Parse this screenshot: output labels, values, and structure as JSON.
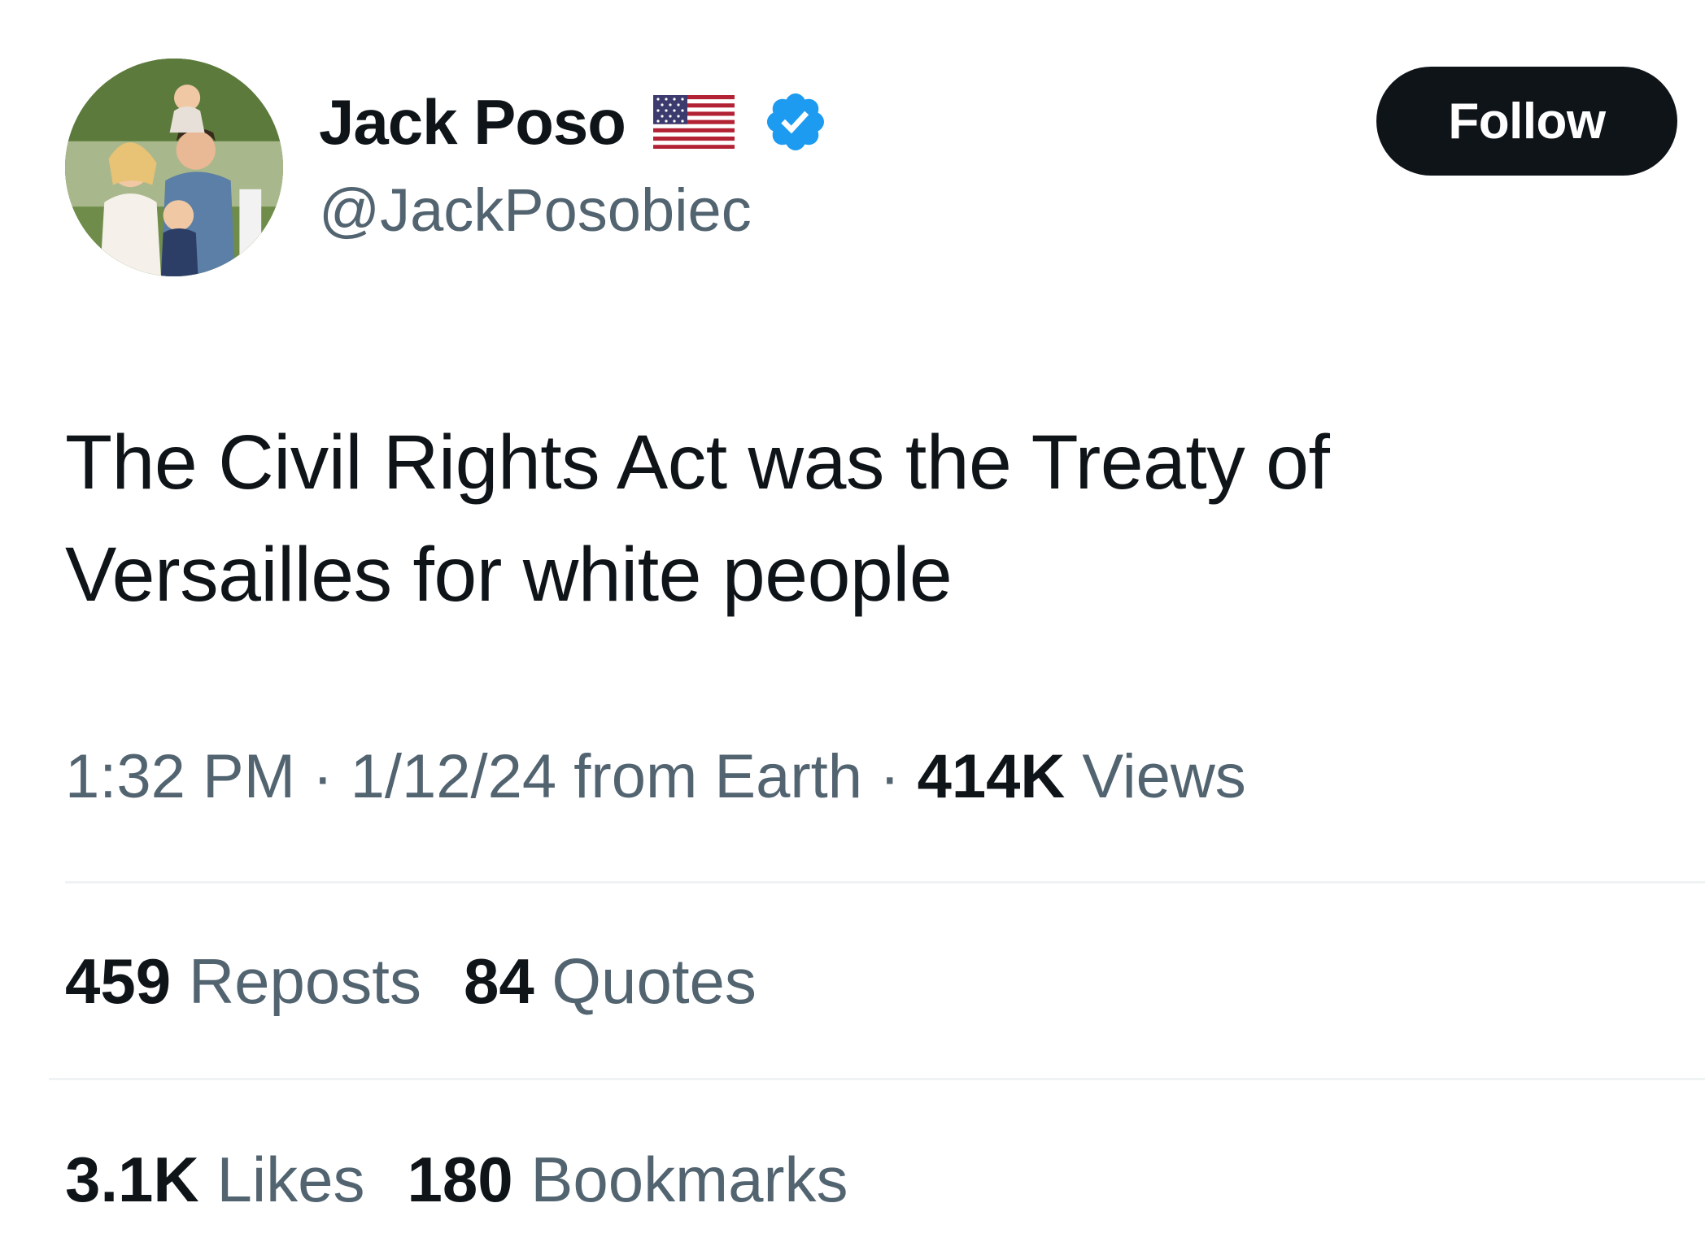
{
  "author": {
    "display_name": "Jack Poso",
    "handle": "@JackPosobiec",
    "flag_icon": "us-flag-icon",
    "verified_icon": "verified-badge-icon",
    "verified_color": "#1d9bf0"
  },
  "follow_button": {
    "label": "Follow"
  },
  "tweet": {
    "text": "The Civil Rights Act was the Treaty of Versailles for white people"
  },
  "meta": {
    "time": "1:32 PM",
    "separator": " · ",
    "date": "1/12/24",
    "source": "from Earth",
    "views_count": "414K",
    "views_label": "Views"
  },
  "stats": {
    "reposts_count": "459",
    "reposts_label": "Reposts",
    "quotes_count": "84",
    "quotes_label": "Quotes",
    "likes_count": "3.1K",
    "likes_label": "Likes",
    "bookmarks_count": "180",
    "bookmarks_label": "Bookmarks"
  },
  "colors": {
    "text_primary": "#0f1419",
    "text_secondary": "#536471",
    "divider": "#eff3f4",
    "button_bg": "#0f1419",
    "button_text": "#ffffff"
  }
}
